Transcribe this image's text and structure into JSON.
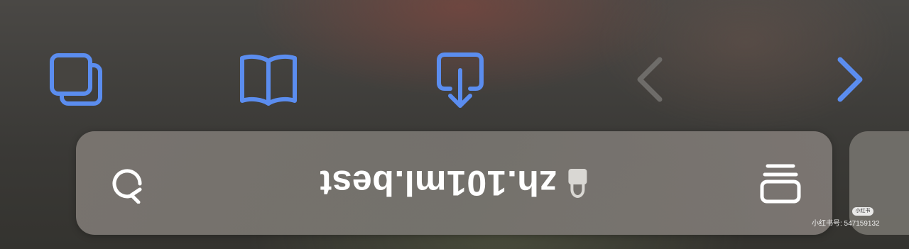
{
  "toolbar": {
    "items": [
      {
        "name": "tabs-button",
        "icon": "tabs-overview-icon",
        "enabled": true
      },
      {
        "name": "bookmarks-button",
        "icon": "book-icon",
        "enabled": true
      },
      {
        "name": "share-button",
        "icon": "share-icon",
        "enabled": true
      },
      {
        "name": "back-button",
        "icon": "chevron-left-icon",
        "enabled": false
      },
      {
        "name": "forward-button",
        "icon": "chevron-right-icon",
        "enabled": true
      }
    ]
  },
  "address_bar": {
    "url": "zh.101ml.best",
    "secure_icon": "lock-icon",
    "reload_icon": "reload-icon",
    "reader_icon": "page-menu-icon",
    "rotated_180": true
  },
  "watermark": {
    "badge": "小红书",
    "text": "小红书号: 547159132"
  },
  "colors": {
    "accent": "#5b8def",
    "disabled": "#6e6c69",
    "bar_bg": "#7d7873",
    "text": "#ffffff"
  }
}
